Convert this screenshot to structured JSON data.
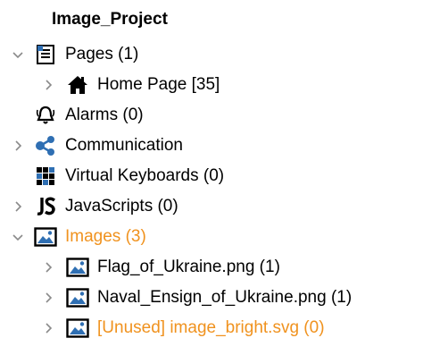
{
  "tree": {
    "title": "Image_Project",
    "items": [
      {
        "label": "Pages (1)",
        "icon": "page-icon",
        "state": "expanded"
      },
      {
        "label": "Home Page [35]",
        "icon": "home-icon",
        "state": "collapsed"
      },
      {
        "label": "Alarms (0)",
        "icon": "alarm-bell-icon",
        "state": "leaf"
      },
      {
        "label": "Communication",
        "icon": "communication-icon",
        "state": "collapsed"
      },
      {
        "label": "Virtual Keyboards (0)",
        "icon": "keyboard-icon",
        "state": "leaf"
      },
      {
        "label": "JavaScripts (0)",
        "icon": "javascript-icon",
        "state": "collapsed"
      },
      {
        "label": "Images (3)",
        "icon": "image-icon",
        "state": "expanded"
      },
      {
        "label": "Flag_of_Ukraine.png (1)",
        "icon": "image-icon",
        "state": "collapsed"
      },
      {
        "label": "Naval_Ensign_of_Ukraine.png (1)",
        "icon": "image-icon",
        "state": "collapsed"
      },
      {
        "label": "[Unused] image_bright.svg (0)",
        "icon": "image-icon",
        "state": "collapsed"
      }
    ]
  },
  "colors": {
    "text": "#000000",
    "highlight": "#f0921e",
    "chevron": "#8a8a8a",
    "icon_blue": "#2f6fb3"
  }
}
